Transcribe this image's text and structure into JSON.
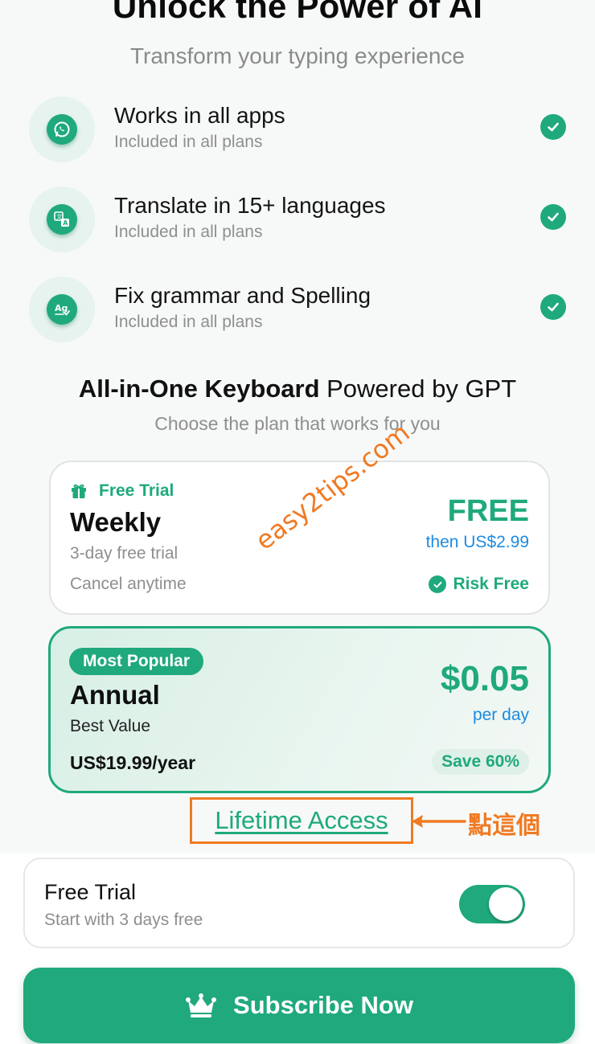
{
  "hero": {
    "title": "Unlock the Power of AI",
    "subtitle": "Transform your typing experience"
  },
  "features": [
    {
      "title": "Works in all apps",
      "subtitle": "Included in all plans",
      "icon": "whatsapp-icon"
    },
    {
      "title": "Translate in 15+ languages",
      "subtitle": "Included in all plans",
      "icon": "translate-icon"
    },
    {
      "title": "Fix grammar and Spelling",
      "subtitle": "Included in all plans",
      "icon": "grammar-icon"
    }
  ],
  "section": {
    "title_bold": "All-in-One Keyboard",
    "title_rest": " Powered by GPT",
    "subtitle": "Choose the plan that works for you"
  },
  "plans": {
    "weekly": {
      "tag": "Free Trial",
      "name": "Weekly",
      "line1": "3-day free trial",
      "line2": "Cancel anytime",
      "price": "FREE",
      "then": "then US$2.99",
      "risk": "Risk Free"
    },
    "annual": {
      "badge": "Most Popular",
      "name": "Annual",
      "best": "Best Value",
      "yearly": "US$19.99/year",
      "price": "$0.05",
      "per": "per day",
      "save": "Save 60%"
    }
  },
  "lifetime": {
    "label": "Lifetime Access"
  },
  "annotation": {
    "note": "點這個",
    "watermark": "easy2tips.com"
  },
  "trial_toggle": {
    "title": "Free Trial",
    "subtitle": "Start with 3 days free",
    "enabled": true
  },
  "subscribe": {
    "label": "Subscribe Now",
    "icon": "crown-icon"
  },
  "colors": {
    "accent": "#1fa97d",
    "link_blue": "#1e8be0",
    "annotation_orange": "#f07a22"
  }
}
